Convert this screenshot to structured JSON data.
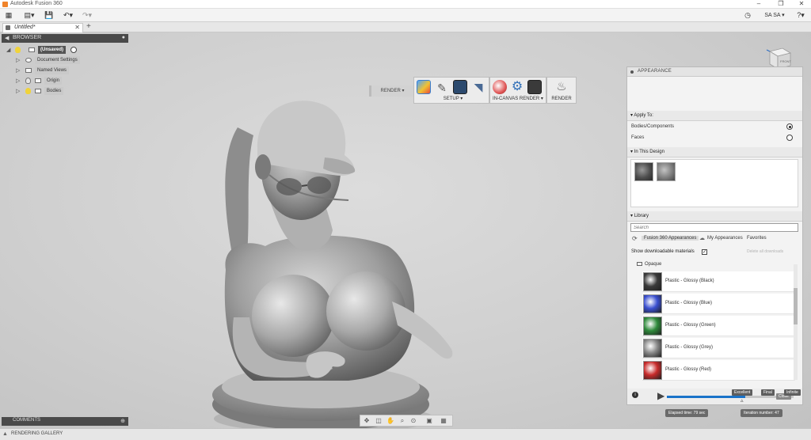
{
  "window": {
    "title": "Autodesk Fusion 360"
  },
  "toolbar": {
    "user": "SA SA"
  },
  "tab": {
    "label": "Untitled*"
  },
  "browser": {
    "title": "BROWSER",
    "root": "(Unsaved)",
    "items": [
      {
        "label": "Document Settings"
      },
      {
        "label": "Named Views"
      },
      {
        "label": "Origin"
      },
      {
        "label": "Bodies"
      }
    ]
  },
  "render_toolbar": {
    "workspace": "RENDER ▾",
    "setup_label": "SETUP ▾",
    "incanvas_label": "IN-CANVAS RENDER ▾",
    "render_label": "RENDER"
  },
  "viewcube": {
    "face": "FRONT"
  },
  "appearance": {
    "title": "APPEARANCE",
    "apply_to": {
      "header": "Apply To:",
      "options": [
        {
          "label": "Bodies/Components",
          "selected": true
        },
        {
          "label": "Faces",
          "selected": false
        }
      ]
    },
    "in_design": {
      "header": "In This Design"
    },
    "library": {
      "header": "Library",
      "search_placeholder": "Search",
      "tabs": [
        "Fusion 360 Appearances",
        "My Appearances",
        "Favorites"
      ],
      "show_downloadable": "Show downloadable materials",
      "show_downloadable_checked": true,
      "clear_downloads": "Delete all downloads",
      "folder": "Opaque",
      "materials": [
        {
          "label": "Plastic - Glossy (Black)",
          "color": "#3a3a3a"
        },
        {
          "label": "Plastic - Glossy (Blue)",
          "color": "#3a4fd0"
        },
        {
          "label": "Plastic - Glossy (Green)",
          "color": "#2f8a3b"
        },
        {
          "label": "Plastic - Glossy (Grey)",
          "color": "#8a8a8a"
        },
        {
          "label": "Plastic - Glossy (Red)",
          "color": "#c82a2a"
        }
      ]
    }
  },
  "render_progress": {
    "quality_labels": [
      "Excellent",
      "Final",
      "Infinite"
    ],
    "close_label": "Close",
    "elapsed": "Elapsed time: 79 sec",
    "iteration": "Iteration number: 47"
  },
  "comments": {
    "label": "COMMENTS"
  },
  "statusbar": {
    "label": "RENDERING GALLERY"
  },
  "colors": {
    "accent": "#1a73c9",
    "panel_dark": "#4a4a4a"
  }
}
